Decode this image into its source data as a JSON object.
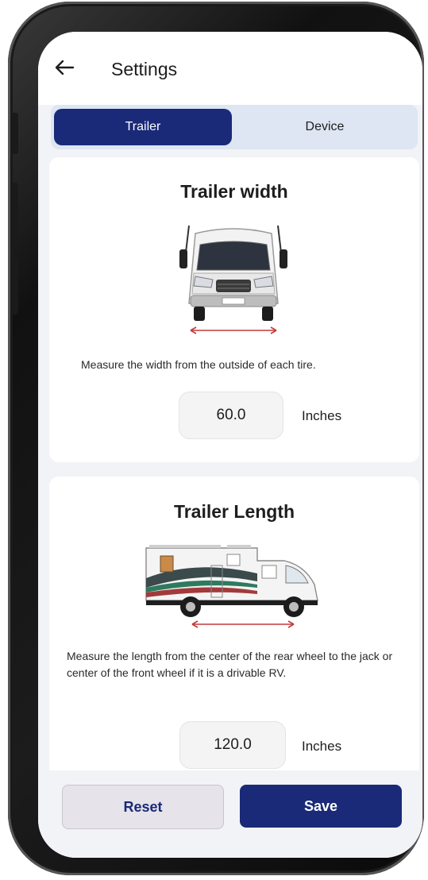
{
  "header": {
    "title": "Settings",
    "back_icon": "arrow-left-icon"
  },
  "tabs": [
    {
      "label": "Trailer",
      "active": true
    },
    {
      "label": "Device",
      "active": false
    }
  ],
  "trailer_width": {
    "title": "Trailer width",
    "description": "Measure the width from the outside of each tire.",
    "value": "60.0",
    "unit": "Inches"
  },
  "trailer_length": {
    "title": "Trailer Length",
    "description": "Measure the length from the center of the rear wheel to the jack or center of the front wheel if it is a drivable RV.",
    "value": "120.0",
    "unit": "Inches"
  },
  "actions": {
    "reset_label": "Reset",
    "save_label": "Save"
  },
  "colors": {
    "primary": "#1a2a78",
    "tab_bg": "#dde6f2",
    "measure_arrow": "#c43a3a",
    "screen_bg": "#f1f3f6"
  }
}
